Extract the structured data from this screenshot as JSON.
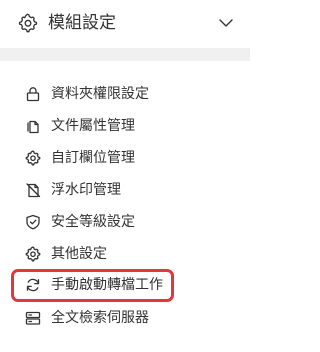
{
  "header": {
    "title": "模組設定",
    "icon": "gear-icon",
    "toggle_icon": "chevron-down-icon"
  },
  "menu": {
    "items": [
      {
        "label": "資料夾權限設定",
        "icon": "lock-icon"
      },
      {
        "label": "文件屬性管理",
        "icon": "documents-icon"
      },
      {
        "label": "自訂欄位管理",
        "icon": "gear-icon"
      },
      {
        "label": "浮水印管理",
        "icon": "watermark-icon"
      },
      {
        "label": "安全等級設定",
        "icon": "shield-icon"
      },
      {
        "label": "其他設定",
        "icon": "gear-icon"
      },
      {
        "label": "手動啟動轉檔工作",
        "icon": "sync-icon",
        "highlighted": true
      },
      {
        "label": "全文檢索伺服器",
        "icon": "server-icon"
      }
    ]
  },
  "colors": {
    "highlight": "#e5363d",
    "divider": "#f0f0f0",
    "text": "#333333"
  }
}
